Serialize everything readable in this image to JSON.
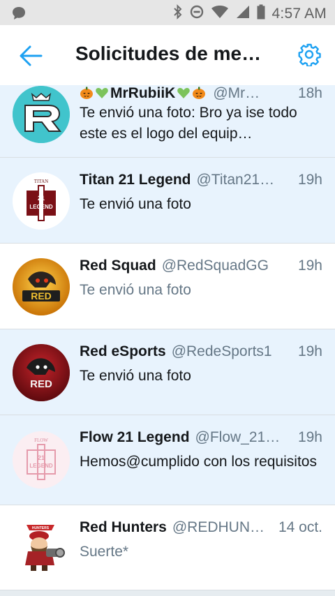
{
  "status_bar": {
    "time": "4:57 AM"
  },
  "header": {
    "title": "Solicitudes de men…"
  },
  "colors": {
    "accent": "#1da1f2",
    "unread_bg": "#e8f3fd"
  },
  "conversations": [
    {
      "name": "MrRubiiK",
      "name_decorations": [
        "pumpkin-emoji",
        "green-heart-emoji",
        "green-heart-emoji",
        "pumpkin-emoji"
      ],
      "handle": "@Mr…",
      "time": "18h",
      "message": "Te envió una foto: Bro ya ise todo este es el logo del equip…",
      "unread": true,
      "avatar": "rubiik-logo-avatar"
    },
    {
      "name": "Titan 21 Legend",
      "handle": "@Titan21…",
      "time": "19h",
      "message": "Te envió una foto",
      "unread": true,
      "avatar": "titan-21-legend-avatar"
    },
    {
      "name": "Red Squad",
      "handle": "@RedSquadGG",
      "time": "19h",
      "message": "Te envió una foto",
      "unread": false,
      "avatar": "red-squad-avatar"
    },
    {
      "name": "Red eSports",
      "handle": "@RedeSports1",
      "time": "19h",
      "message": "Te envió una foto",
      "unread": true,
      "avatar": "red-esports-avatar"
    },
    {
      "name": "Flow 21 Legend",
      "handle": "@Flow_21…",
      "time": "19h",
      "message": "Hemos@cumplido con los requisitos",
      "unread": true,
      "avatar": "flow-21-legend-avatar"
    },
    {
      "name": "Red Hunters",
      "handle": "@REDHUN…",
      "time": "14 oct.",
      "message": "Suerte*",
      "unread": false,
      "avatar": "red-hunters-avatar"
    }
  ]
}
